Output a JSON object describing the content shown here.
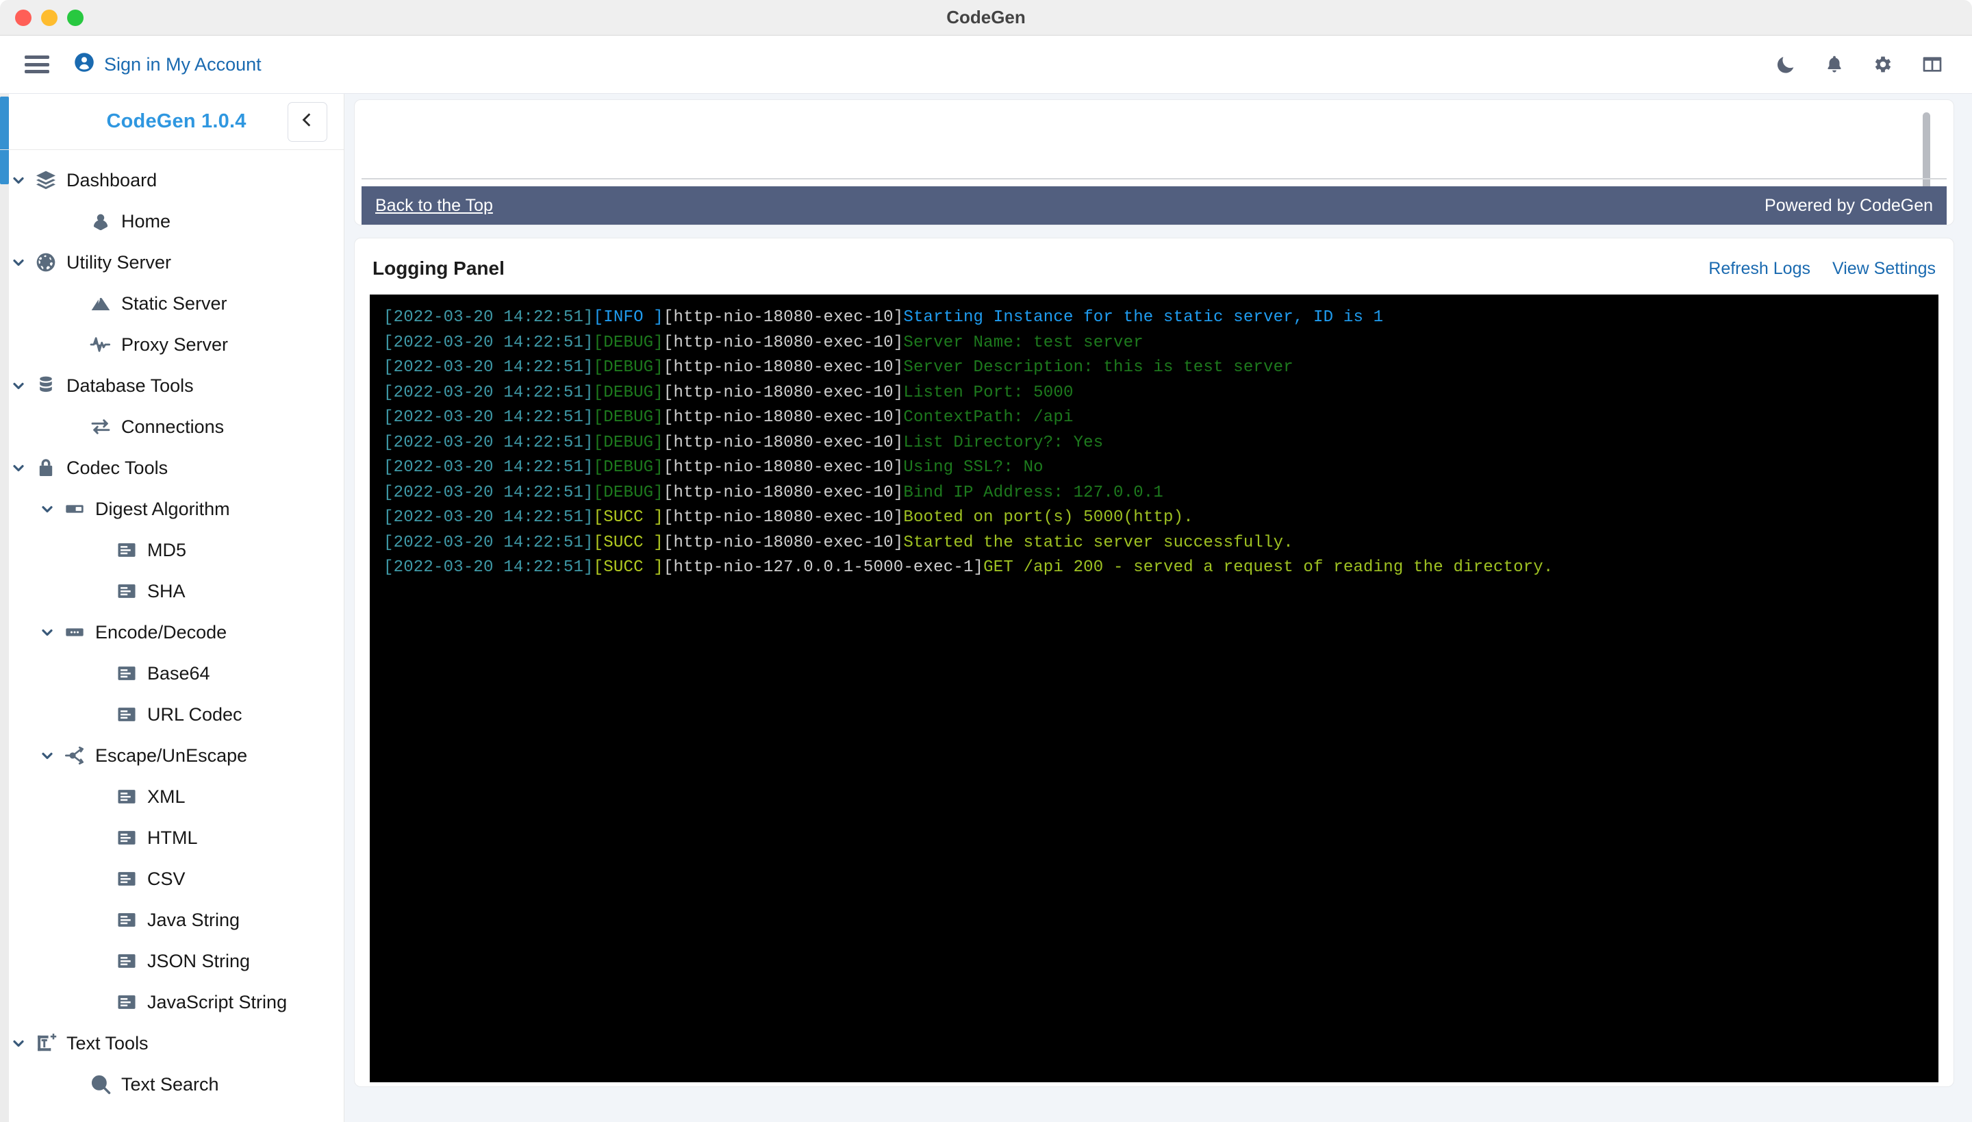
{
  "window": {
    "title": "CodeGen"
  },
  "navbar": {
    "menu_icon": "hamburger-icon",
    "account_label": "Sign in My Account",
    "icons": [
      {
        "name": "moon-icon",
        "label": "Dark Mode"
      },
      {
        "name": "bell-icon",
        "label": "Notifications"
      },
      {
        "name": "gear-icon",
        "label": "Settings"
      },
      {
        "name": "layout-icon",
        "label": "Layout"
      }
    ]
  },
  "sidebar": {
    "brand": "CodeGen 1.0.4",
    "collapse_icon": "chevron-left-icon",
    "items": [
      {
        "label": "Dashboard",
        "icon": "layers-icon",
        "level": 0,
        "expandable": true,
        "expanded": true
      },
      {
        "label": "Home",
        "icon": "location-icon",
        "level": 1,
        "expandable": false
      },
      {
        "label": "Utility Server",
        "icon": "globe-icon",
        "level": 0,
        "expandable": true,
        "expanded": true
      },
      {
        "label": "Static Server",
        "icon": "mountain-icon",
        "level": 1,
        "expandable": false
      },
      {
        "label": "Proxy Server",
        "icon": "pulse-icon",
        "level": 1,
        "expandable": false
      },
      {
        "label": "Database Tools",
        "icon": "database-icon",
        "level": 0,
        "expandable": true,
        "expanded": true
      },
      {
        "label": "Connections",
        "icon": "exchange-icon",
        "level": 1,
        "expandable": false
      },
      {
        "label": "Codec Tools",
        "icon": "lock-icon",
        "level": 0,
        "expandable": true,
        "expanded": true
      },
      {
        "label": "Digest Algorithm",
        "icon": "tag-icon",
        "level": 1,
        "expandable": true,
        "expanded": true
      },
      {
        "label": "MD5",
        "icon": "article-icon",
        "level": 2,
        "expandable": false
      },
      {
        "label": "SHA",
        "icon": "article-icon",
        "level": 2,
        "expandable": false
      },
      {
        "label": "Encode/Decode",
        "icon": "ellipsis-box-icon",
        "level": 1,
        "expandable": true,
        "expanded": true
      },
      {
        "label": "Base64",
        "icon": "article-icon",
        "level": 2,
        "expandable": false
      },
      {
        "label": "URL Codec",
        "icon": "article-icon",
        "level": 2,
        "expandable": false
      },
      {
        "label": "Escape/UnEscape",
        "icon": "share-nodes-icon",
        "level": 1,
        "expandable": true,
        "expanded": true
      },
      {
        "label": "XML",
        "icon": "article-icon",
        "level": 2,
        "expandable": false
      },
      {
        "label": "HTML",
        "icon": "article-icon",
        "level": 2,
        "expandable": false
      },
      {
        "label": "CSV",
        "icon": "article-icon",
        "level": 2,
        "expandable": false
      },
      {
        "label": "Java String",
        "icon": "article-icon",
        "level": 2,
        "expandable": false
      },
      {
        "label": "JSON String",
        "icon": "article-icon",
        "level": 2,
        "expandable": false
      },
      {
        "label": "JavaScript String",
        "icon": "article-icon",
        "level": 2,
        "expandable": false
      },
      {
        "label": "Text Tools",
        "icon": "text-add-icon",
        "level": 0,
        "expandable": true,
        "expanded": true
      },
      {
        "label": "Text Search",
        "icon": "text-search-icon",
        "level": 1,
        "expandable": false
      }
    ]
  },
  "top_card": {
    "back_to_top": "Back to the Top",
    "powered_by": "Powered by CodeGen"
  },
  "logging_panel": {
    "title": "Logging Panel",
    "refresh_label": "Refresh Logs",
    "settings_label": "View Settings",
    "lines": [
      {
        "ts": "[2022-03-20 14:22:51]",
        "level": "[INFO ]",
        "level_key": "info",
        "thread": "[http-nio-18080-exec-10]",
        "msg": "Starting Instance for the static server, ID is 1"
      },
      {
        "ts": "[2022-03-20 14:22:51]",
        "level": "[DEBUG]",
        "level_key": "debug",
        "thread": "[http-nio-18080-exec-10]",
        "msg": "Server Name: test server"
      },
      {
        "ts": "[2022-03-20 14:22:51]",
        "level": "[DEBUG]",
        "level_key": "debug",
        "thread": "[http-nio-18080-exec-10]",
        "msg": "Server Description: this is test server"
      },
      {
        "ts": "[2022-03-20 14:22:51]",
        "level": "[DEBUG]",
        "level_key": "debug",
        "thread": "[http-nio-18080-exec-10]",
        "msg": "Listen Port: 5000"
      },
      {
        "ts": "[2022-03-20 14:22:51]",
        "level": "[DEBUG]",
        "level_key": "debug",
        "thread": "[http-nio-18080-exec-10]",
        "msg": "ContextPath: /api"
      },
      {
        "ts": "[2022-03-20 14:22:51]",
        "level": "[DEBUG]",
        "level_key": "debug",
        "thread": "[http-nio-18080-exec-10]",
        "msg": "List Directory?: Yes"
      },
      {
        "ts": "[2022-03-20 14:22:51]",
        "level": "[DEBUG]",
        "level_key": "debug",
        "thread": "[http-nio-18080-exec-10]",
        "msg": "Using SSL?: No"
      },
      {
        "ts": "[2022-03-20 14:22:51]",
        "level": "[DEBUG]",
        "level_key": "debug",
        "thread": "[http-nio-18080-exec-10]",
        "msg": "Bind IP Address: 127.0.0.1"
      },
      {
        "ts": "[2022-03-20 14:22:51]",
        "level": "[SUCC ]",
        "level_key": "succ",
        "thread": "[http-nio-18080-exec-10]",
        "msg": "Booted on port(s) 5000(http)."
      },
      {
        "ts": "[2022-03-20 14:22:51]",
        "level": "[SUCC ]",
        "level_key": "succ",
        "thread": "[http-nio-18080-exec-10]",
        "msg": "Started the static server successfully."
      },
      {
        "ts": "[2022-03-20 14:22:51]",
        "level": "[SUCC ]",
        "level_key": "succ",
        "thread": "[http-nio-127.0.0.1-5000-exec-1]",
        "msg": "GET /api 200 - served a request of reading the directory."
      }
    ]
  },
  "colors": {
    "brand_blue": "#2f97e0",
    "link_blue": "#1a6ab0",
    "footer_bar": "#525f7f",
    "console_bg": "#000000",
    "ts": "#3f9aa8",
    "info": "#1f9cf0",
    "debug": "#1d7a1d",
    "succ": "#b3cb21",
    "thread": "#cfcfcf"
  }
}
